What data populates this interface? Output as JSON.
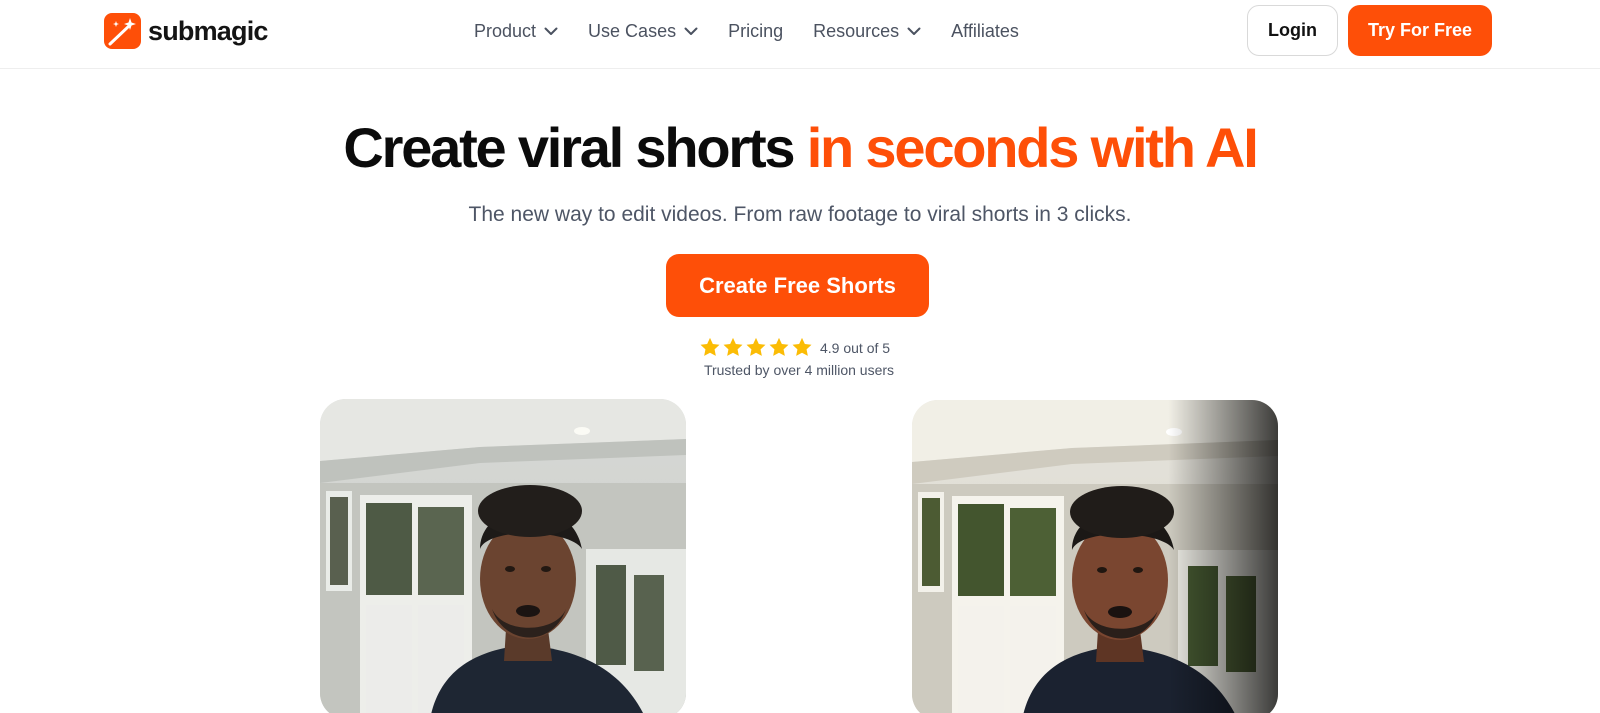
{
  "brand": {
    "name": "submagic",
    "color": "#fe4f08",
    "icon": "magic-wand-icon"
  },
  "nav": {
    "items": [
      {
        "label": "Product",
        "has_dropdown": true
      },
      {
        "label": "Use Cases",
        "has_dropdown": true
      },
      {
        "label": "Pricing",
        "has_dropdown": false
      },
      {
        "label": "Resources",
        "has_dropdown": true
      },
      {
        "label": "Affiliates",
        "has_dropdown": false
      }
    ]
  },
  "header": {
    "login_label": "Login",
    "try_label": "Try For Free"
  },
  "hero": {
    "headline_dark": "Create viral shorts",
    "headline_accent": "in seconds with AI",
    "subheadline": "The new way to edit videos. From raw footage to viral shorts in 3 clicks.",
    "cta_label": "Create Free Shorts"
  },
  "rating": {
    "stars": 5,
    "score_text": "4.9 out of 5",
    "trusted_text": "Trusted by over 4 million users",
    "star_color": "#fbbc05"
  },
  "videos": [
    {
      "name": "before-video",
      "description_icon": "video-thumbnail"
    },
    {
      "name": "after-video",
      "description_icon": "video-thumbnail"
    }
  ]
}
